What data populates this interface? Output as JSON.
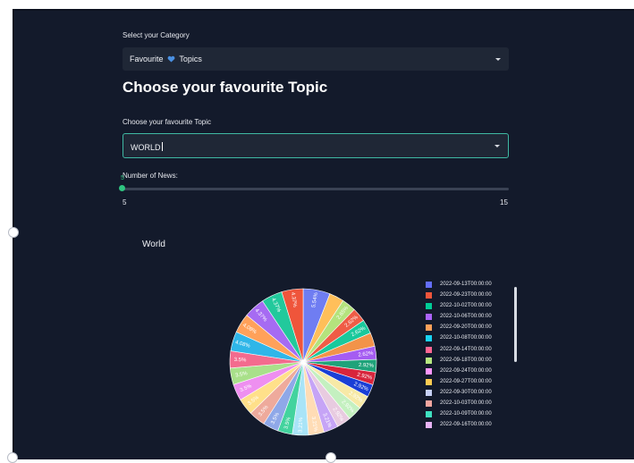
{
  "category": {
    "label": "Select your Category",
    "value_left": "Favourite",
    "value_right": "Topics",
    "heart_color": "#4a90e2"
  },
  "heading": "Choose your favourite Topic",
  "topic": {
    "label": "Choose your favourite Topic",
    "value": "WORLD"
  },
  "news_slider": {
    "label": "Number of News:",
    "value": 5,
    "value_text": "5",
    "min": "5",
    "max": "15"
  },
  "chart_title": "World",
  "chart_data": {
    "type": "pie",
    "title": "World",
    "slices": [
      {
        "pct": 5.54,
        "label": "5.54%",
        "color": "#6f7df2"
      },
      {
        "pct": 3.0,
        "label": "",
        "color": "#ffbf5a"
      },
      {
        "pct": 2.9,
        "label": "2.65%",
        "color": "#b4e37d"
      },
      {
        "pct": 2.9,
        "label": "2.62%",
        "color": "#ef5c46"
      },
      {
        "pct": 2.9,
        "label": "2.62%",
        "color": "#19c99c"
      },
      {
        "pct": 2.8,
        "label": "",
        "color": "#f29349"
      },
      {
        "pct": 2.7,
        "label": "2.62%",
        "color": "#a55cf2"
      },
      {
        "pct": 2.6,
        "label": "2.92%",
        "color": "#1fa37a"
      },
      {
        "pct": 2.6,
        "label": "2.92%",
        "color": "#d8253c"
      },
      {
        "pct": 2.6,
        "label": "2.92%",
        "color": "#1a3fd6"
      },
      {
        "pct": 2.8,
        "label": "2.92%",
        "color": "#f7e9a6"
      },
      {
        "pct": 3.0,
        "label": "2.92%",
        "color": "#c4f0c0"
      },
      {
        "pct": 2.9,
        "label": "2.92%",
        "color": "#e8cbe0"
      },
      {
        "pct": 3.0,
        "label": "3.21%",
        "color": "#c6a4f6"
      },
      {
        "pct": 3.2,
        "label": "3.21%",
        "color": "#ffdcb5"
      },
      {
        "pct": 3.3,
        "label": "3.21%",
        "color": "#a9e4f7"
      },
      {
        "pct": 3.0,
        "label": "3.5%",
        "color": "#43d39e"
      },
      {
        "pct": 3.2,
        "label": "3.5%",
        "color": "#8fa8e8"
      },
      {
        "pct": 3.4,
        "label": "3.5%",
        "color": "#eeaa9c"
      },
      {
        "pct": 3.4,
        "label": "3.5%",
        "color": "#ffe08a"
      },
      {
        "pct": 3.4,
        "label": "3.5%",
        "color": "#ee8ff0"
      },
      {
        "pct": 3.4,
        "label": "3.5%",
        "color": "#a9e08a"
      },
      {
        "pct": 3.5,
        "label": "3.5%",
        "color": "#f36b8e"
      },
      {
        "pct": 4.0,
        "label": "4.08%",
        "color": "#2fb6e8"
      },
      {
        "pct": 4.0,
        "label": "4.08%",
        "color": "#ffa15a"
      },
      {
        "pct": 4.3,
        "label": "4.37%",
        "color": "#a66bf2"
      },
      {
        "pct": 4.3,
        "label": "4.37%",
        "color": "#22c99c"
      },
      {
        "pct": 4.4,
        "label": "4.37%",
        "color": "#ef553b"
      }
    ]
  },
  "legend": [
    {
      "label": "2022-09-13T00:00:00",
      "color": "#636efa"
    },
    {
      "label": "2022-09-23T00:00:00",
      "color": "#ef553b"
    },
    {
      "label": "2022-10-02T00:00:00",
      "color": "#00cc96"
    },
    {
      "label": "2022-10-06T00:00:00",
      "color": "#ab63fa"
    },
    {
      "label": "2022-09-20T00:00:00",
      "color": "#ffa15a"
    },
    {
      "label": "2022-10-08T00:00:00",
      "color": "#19d3f3"
    },
    {
      "label": "2022-09-14T00:00:00",
      "color": "#ff6692"
    },
    {
      "label": "2022-09-18T00:00:00",
      "color": "#b6e880"
    },
    {
      "label": "2022-09-24T00:00:00",
      "color": "#ff97ff"
    },
    {
      "label": "2022-09-27T00:00:00",
      "color": "#fecb52"
    },
    {
      "label": "2022-09-30T00:00:00",
      "color": "#c6d0f5"
    },
    {
      "label": "2022-10-03T00:00:00",
      "color": "#f4a6a0"
    },
    {
      "label": "2022-10-09T00:00:00",
      "color": "#3fe0c0"
    },
    {
      "label": "2022-09-16T00:00:00",
      "color": "#e7b3f5"
    }
  ]
}
